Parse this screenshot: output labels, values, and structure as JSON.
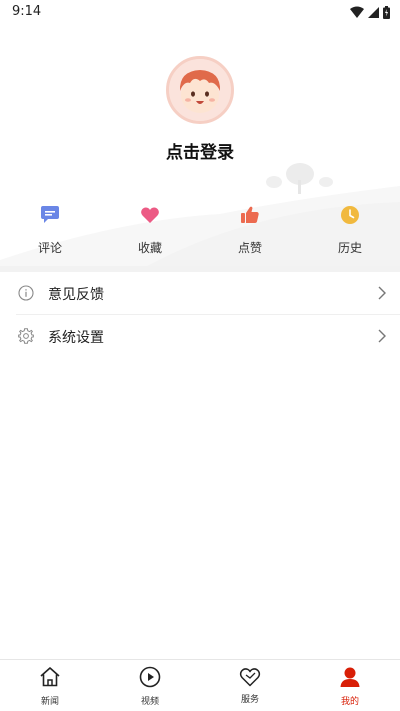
{
  "status_bar": {
    "time": "9:14"
  },
  "profile": {
    "login_text": "点击登录"
  },
  "quick_actions": [
    {
      "label": "评论",
      "icon": "comment-icon",
      "color": "#6a86e6"
    },
    {
      "label": "收藏",
      "icon": "heart-icon",
      "color": "#ec5a84"
    },
    {
      "label": "点赞",
      "icon": "thumbs-up-icon",
      "color": "#ec6a4f"
    },
    {
      "label": "历史",
      "icon": "clock-icon",
      "color": "#f1b93e"
    }
  ],
  "menu": [
    {
      "label": "意见反馈",
      "icon": "info-icon"
    },
    {
      "label": "系统设置",
      "icon": "gear-icon"
    }
  ],
  "bottom_nav": [
    {
      "label": "新闻",
      "icon": "home-icon",
      "active": false
    },
    {
      "label": "视频",
      "icon": "play-icon",
      "active": false
    },
    {
      "label": "服务",
      "icon": "heart-outline-icon",
      "active": false
    },
    {
      "label": "我的",
      "icon": "user-icon",
      "active": true
    }
  ],
  "colors": {
    "accent": "#d81e06",
    "divider": "#f2f2f2"
  }
}
